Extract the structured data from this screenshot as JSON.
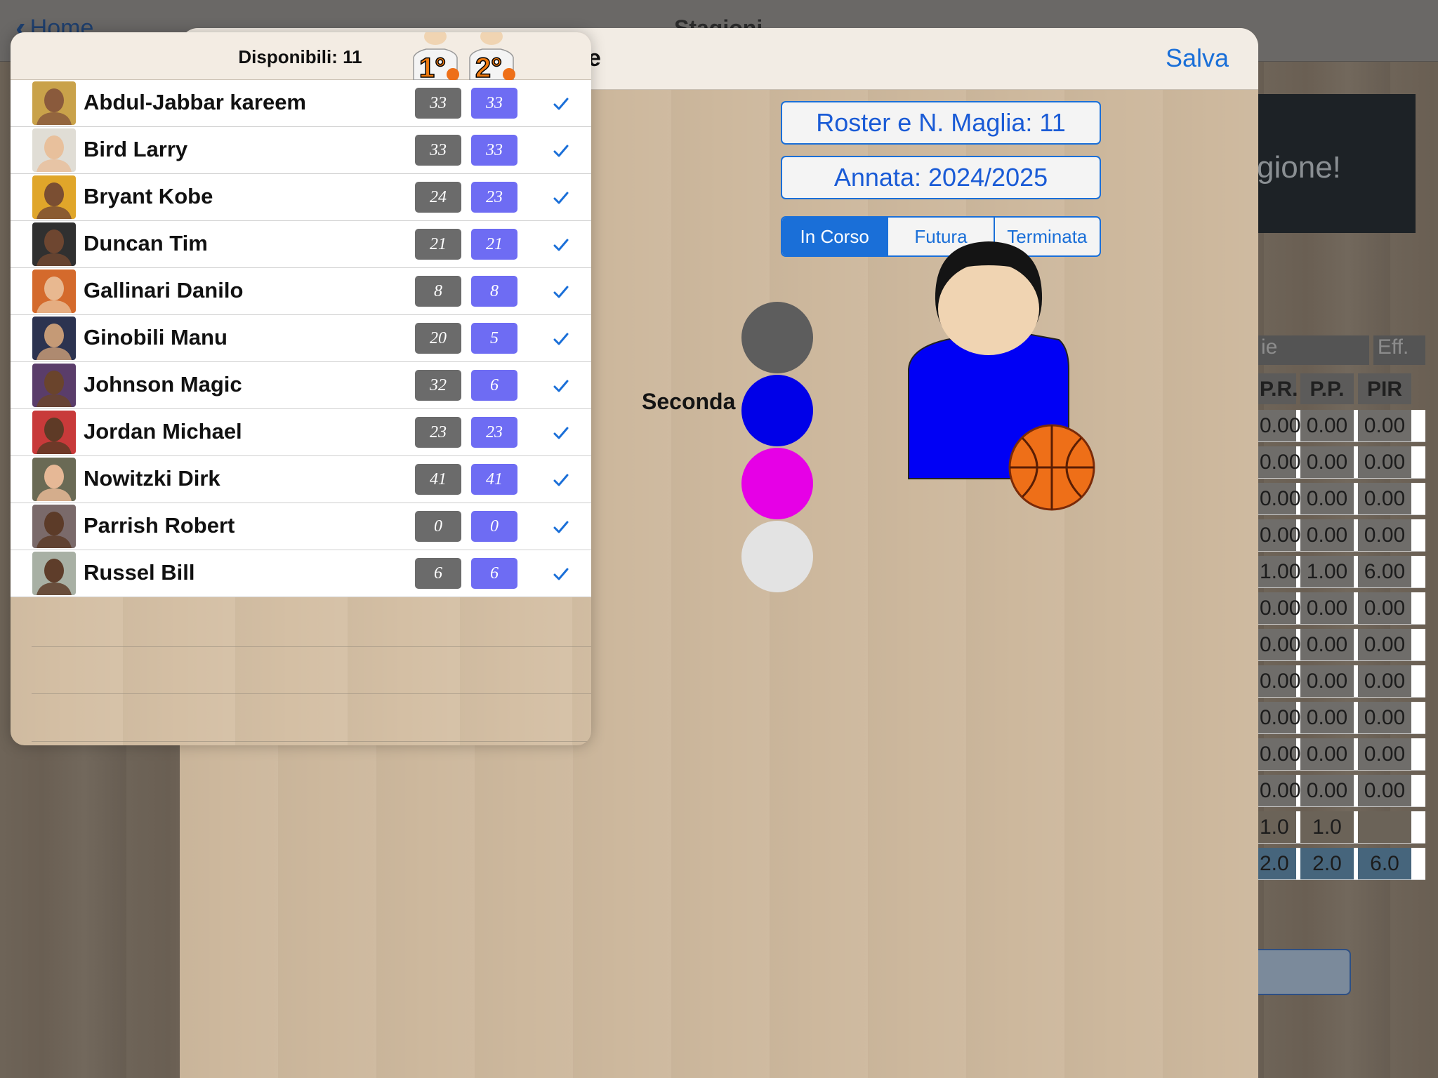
{
  "background": {
    "back_label": "Home",
    "title": "Stagioni",
    "banner_text": "gione!",
    "table": {
      "header_left": "ie",
      "header_right": "Eff.",
      "columns": [
        "P.R.",
        "P.P.",
        "PIR"
      ],
      "rows": [
        [
          "0.00",
          "0.00",
          "0.00"
        ],
        [
          "0.00",
          "0.00",
          "0.00"
        ],
        [
          "0.00",
          "0.00",
          "0.00"
        ],
        [
          "0.00",
          "0.00",
          "0.00"
        ],
        [
          "1.00",
          "1.00",
          "6.00"
        ],
        [
          "0.00",
          "0.00",
          "0.00"
        ],
        [
          "0.00",
          "0.00",
          "0.00"
        ],
        [
          "0.00",
          "0.00",
          "0.00"
        ],
        [
          "0.00",
          "0.00",
          "0.00"
        ],
        [
          "0.00",
          "0.00",
          "0.00"
        ],
        [
          "0.00",
          "0.00",
          "0.00"
        ],
        [
          "1.0",
          "1.0",
          ""
        ],
        [
          "2.0",
          "2.0",
          "6.0"
        ]
      ]
    }
  },
  "sheet": {
    "title": "ione",
    "save_label": "Salva",
    "roster_field": "Roster e N. Maglia: 11",
    "season_field": "Annata: 2024/2025",
    "segments": [
      "In Corso",
      "Futura",
      "Terminata"
    ],
    "active_segment": "In Corso",
    "kit_label": "Seconda",
    "swatch_colors": [
      "#5d5d5d",
      "#0000e8",
      "#e600e6",
      "#e3e3e3"
    ],
    "jersey_color": "#0000f5"
  },
  "popover": {
    "title": "Disponibili: 11",
    "col1_label": "1°",
    "col2_label": "2°",
    "players": [
      {
        "name": "Abdul-Jabbar kareem",
        "n1": "33",
        "n2": "33",
        "skin": "#8a5a3c",
        "bg": "#c9a24a"
      },
      {
        "name": "Bird Larry",
        "n1": "33",
        "n2": "33",
        "skin": "#e8c09c",
        "bg": "#e0ddd5"
      },
      {
        "name": "Bryant Kobe",
        "n1": "24",
        "n2": "23",
        "skin": "#7a4e32",
        "bg": "#e0a62a"
      },
      {
        "name": "Duncan Tim",
        "n1": "21",
        "n2": "21",
        "skin": "#6e4630",
        "bg": "#303030"
      },
      {
        "name": "Gallinari Danilo",
        "n1": "8",
        "n2": "8",
        "skin": "#e8b890",
        "bg": "#d46a2c"
      },
      {
        "name": "Ginobili Manu",
        "n1": "20",
        "n2": "5",
        "skin": "#c59a76",
        "bg": "#2c3350"
      },
      {
        "name": "Johnson Magic",
        "n1": "32",
        "n2": "6",
        "skin": "#6a442c",
        "bg": "#5a3d6a"
      },
      {
        "name": "Jordan Michael",
        "n1": "23",
        "n2": "23",
        "skin": "#5e3a26",
        "bg": "#c83a3a"
      },
      {
        "name": "Nowitzki Dirk",
        "n1": "41",
        "n2": "41",
        "skin": "#e6b896",
        "bg": "#6a6a55"
      },
      {
        "name": "Parrish Robert",
        "n1": "0",
        "n2": "0",
        "skin": "#5c3b28",
        "bg": "#7a6a6a"
      },
      {
        "name": "Russel Bill",
        "n1": "6",
        "n2": "6",
        "skin": "#5e3d2a",
        "bg": "#a8b0a4"
      }
    ]
  }
}
